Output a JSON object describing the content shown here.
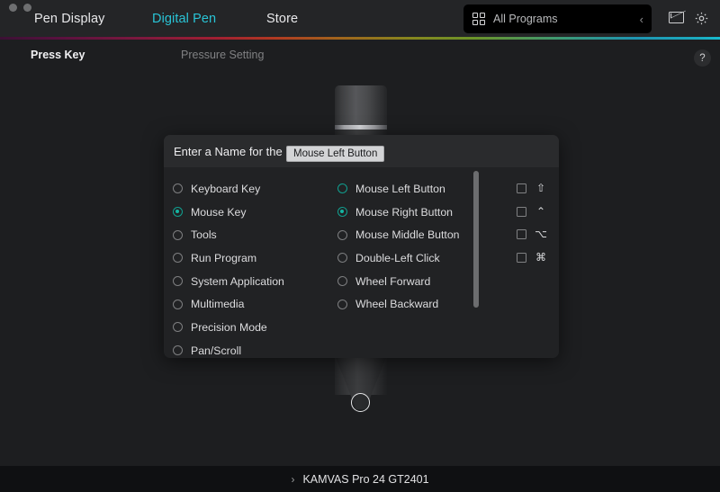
{
  "window": {
    "dots": [
      "window-dot-close",
      "window-dot-minimize"
    ]
  },
  "topnav": {
    "items": [
      {
        "label": "Pen Display",
        "active": false
      },
      {
        "label": "Digital Pen",
        "active": true
      },
      {
        "label": "Store",
        "active": false
      }
    ],
    "program_select": {
      "label": "All Programs",
      "chevron": "‹",
      "icon": "grid-icon"
    },
    "mail_icon": "mail-icon",
    "settings_icon": "gear-icon",
    "accent_color": "#29c4d6"
  },
  "subnav": {
    "items": [
      {
        "label": "Press Key",
        "active": true
      },
      {
        "label": "Pressure Setting",
        "active": false
      }
    ],
    "help_label": "?"
  },
  "dialog": {
    "title": "Enter a Name for the K",
    "categories": [
      {
        "label": "Keyboard Key",
        "selected": false
      },
      {
        "label": "Mouse Key",
        "selected": true
      },
      {
        "label": "Tools",
        "selected": false
      },
      {
        "label": "Run Program",
        "selected": false
      },
      {
        "label": "System Application",
        "selected": false
      },
      {
        "label": "Multimedia",
        "selected": false
      },
      {
        "label": "Precision Mode",
        "selected": false
      },
      {
        "label": "Pan/Scroll",
        "selected": false
      }
    ],
    "options": [
      {
        "label": "Mouse Left Button",
        "selected": false,
        "hover": true,
        "has_modifier": true,
        "modifier_checked": false,
        "modifier_glyph": "⇧"
      },
      {
        "label": "Mouse Right Button",
        "selected": true,
        "hover": false,
        "has_modifier": true,
        "modifier_checked": false,
        "modifier_glyph": "⌃"
      },
      {
        "label": "Mouse Middle Button",
        "selected": false,
        "hover": false,
        "has_modifier": true,
        "modifier_checked": false,
        "modifier_glyph": "⌥"
      },
      {
        "label": "Double-Left Click",
        "selected": false,
        "hover": false,
        "has_modifier": true,
        "modifier_checked": false,
        "modifier_glyph": "⌘"
      },
      {
        "label": "Wheel Forward",
        "selected": false,
        "hover": false,
        "has_modifier": false,
        "modifier_checked": false,
        "modifier_glyph": ""
      },
      {
        "label": "Wheel Backward",
        "selected": false,
        "hover": false,
        "has_modifier": false,
        "modifier_checked": false,
        "modifier_glyph": ""
      }
    ],
    "selected_radio_color": "#15b5a2"
  },
  "tooltip": {
    "text": "Mouse Left Button"
  },
  "device_bar": {
    "chevron": "›",
    "label": "KAMVAS Pro 24 GT2401"
  }
}
